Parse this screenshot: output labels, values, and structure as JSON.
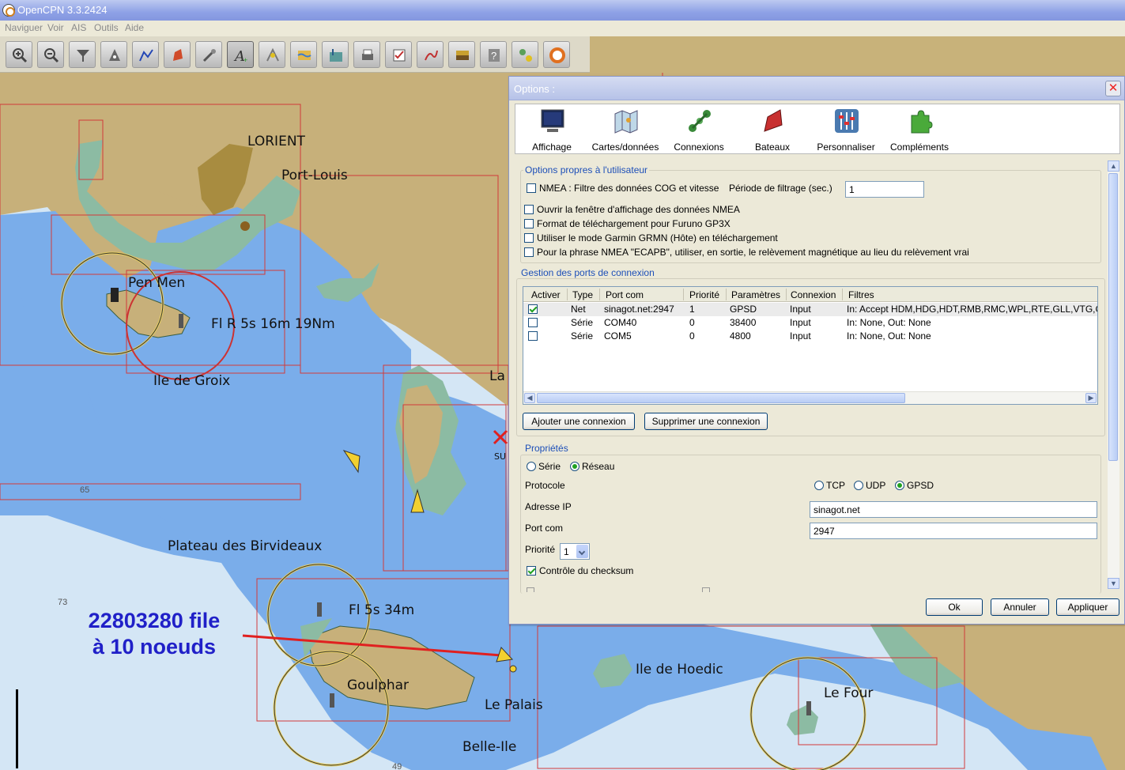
{
  "window": {
    "title": "OpenCPN 3.3.2424"
  },
  "menu": [
    "Naviguer",
    "Voir",
    "AIS",
    "Outils",
    "Aide"
  ],
  "toolbar": {
    "buttons": [
      "zoom-in",
      "zoom-out",
      "quilt",
      "waypoint",
      "route",
      "ship",
      "settings",
      "text",
      "tide",
      "current",
      "print",
      "route-manager",
      "track",
      "chart",
      "help",
      "ais",
      "lifebuoy"
    ]
  },
  "map": {
    "labels": {
      "lorient": "LORIENT",
      "port_louis": "Port-Louis",
      "pen_men": "Pen Men",
      "light_groix": "Fl R 5s 16m 19Nm",
      "ile_de_groix": "Ile de Groix",
      "la": "La",
      "su": "SU",
      "plateau": "Plateau des Birvideaux",
      "light_belle": "Fl 5s 34m",
      "goulphar": "Goulphar",
      "le_palais": "Le Palais",
      "belle_ile": "Belle-Ile",
      "hoedic": "Ile de Hoedic",
      "le_four": "Le Four"
    },
    "depths": {
      "d65": "65",
      "d73": "73",
      "d49": "49"
    },
    "annotation": {
      "line1": "22803280 file",
      "line2": "à 10 noeuds"
    },
    "colors": {
      "land": "#c7b07a",
      "shallow": "#7aadea",
      "deep": "#d4e6f5",
      "drying": "#8cbba3",
      "chart_border": "#d23a3a"
    }
  },
  "dialog": {
    "title": "Options :",
    "tabs": [
      "Affichage",
      "Cartes/données",
      "Connexions",
      "Bateaux",
      "Personnaliser",
      "Compléments"
    ],
    "user_options": {
      "title": "Options propres à l'utilisateur",
      "nmea_filter": "NMEA : Filtre des données COG et vitesse",
      "filter_period_label": "Période de filtrage (sec.)",
      "filter_period_value": "1",
      "open_nmea": "Ouvrir la fenêtre d'affichage des données NMEA",
      "furuno": "Format de téléchargement pour Furuno GP3X",
      "garmin": "Utiliser le mode Garmin GRMN (Hôte) en téléchargement",
      "ecapb": "Pour la phrase NMEA \"ECAPB\", utiliser, en sortie, le relèvement magnétique  au lieu du relèvement vrai"
    },
    "ports": {
      "title": "Gestion des ports de connexion",
      "headers": [
        "Activer",
        "Type",
        "Port com",
        "Priorité",
        "Paramètres",
        "Connexion",
        "Filtres"
      ],
      "rows": [
        {
          "enabled": true,
          "type": "Net",
          "port": "sinagot.net:2947",
          "priority": "1",
          "params": "GPSD",
          "conn": "Input",
          "filters": "In: Accept HDM,HDG,HDT,RMB,RMC,WPL,RTE,GLL,VTG,G"
        },
        {
          "enabled": false,
          "type": "Série",
          "port": "COM40",
          "priority": "0",
          "params": "38400",
          "conn": "Input",
          "filters": "In: None, Out: None"
        },
        {
          "enabled": false,
          "type": "Série",
          "port": "COM5",
          "priority": "0",
          "params": "4800",
          "conn": "Input",
          "filters": "In: None, Out: None"
        }
      ],
      "add": "Ajouter une connexion",
      "remove": "Supprimer une connexion"
    },
    "props": {
      "title": "Propriétés",
      "serie": "Série",
      "reseau": "Réseau",
      "protocol_label": "Protocole",
      "tcp": "TCP",
      "udp": "UDP",
      "gpsd": "GPSD",
      "ip_label": "Adresse IP",
      "ip_value": "sinagot.net",
      "port_label": "Port com",
      "port_value": "2947",
      "priority_label": "Priorité",
      "priority_value": "1",
      "checksum": "Contrôle du checksum"
    },
    "buttons": {
      "ok": "Ok",
      "cancel": "Annuler",
      "apply": "Appliquer"
    }
  }
}
